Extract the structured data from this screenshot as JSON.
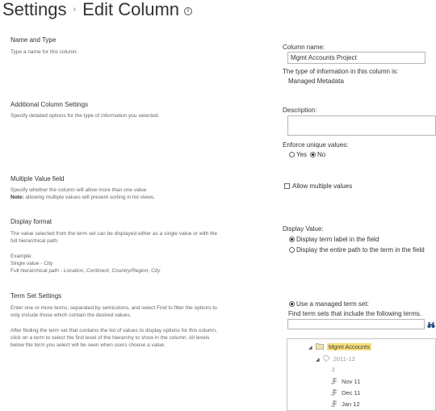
{
  "header": {
    "title": "Settings",
    "separator": "›",
    "subtitle": "Edit Column",
    "info": "i"
  },
  "sections": {
    "name_type": {
      "heading": "Name and Type",
      "desc": "Type a name for this column."
    },
    "additional": {
      "heading": "Additional Column Settings",
      "desc": "Specify detailed options for the type of information you selected."
    },
    "multiple": {
      "heading": "Multiple Value field",
      "desc1": "Specify whether the column will allow more than one value",
      "note_bold": "Note:",
      "note": " allowing multiple values will prevent sorting in list views."
    },
    "display": {
      "heading": "Display format",
      "desc1": "The value selected from the term set can be displayed either as a single value or with the",
      "desc2": "full hierarchical path.",
      "example": "Example:",
      "single": "Single value - City",
      "full_prefix": "Full hierarchical path - ",
      "full_italic": "Location, Continent, Country/Region, City"
    },
    "termset": {
      "heading": "Term Set Settings",
      "desc1": "Enter one or more terms, separated by semicolons, and select Find to filter the options to",
      "desc2": "only include those which contain the desired values.",
      "desc3": "After finding the term set that contains the list of values to display options for this column,",
      "desc4": "click on a term to select the first level of the hierarchy to show in the column. All levels",
      "desc5": "below the term you select will be seen when users choose a value."
    }
  },
  "fields": {
    "column_name_label": "Column name:",
    "column_name_value": "Mgmt Accounts Project",
    "type_label": "The type of information in this column is:",
    "type_value": "Managed Metadata",
    "description_label": "Description:",
    "description_value": "",
    "enforce_label": "Enforce unique values:",
    "enforce_yes": "Yes",
    "enforce_no": "No",
    "enforce_selected": "No",
    "allow_multiple": "Allow multiple values",
    "allow_multiple_checked": false,
    "display_value_label": "Display Value:",
    "display_opt1": "Display term label in the field",
    "display_opt2": "Display the entire path to the term in the field",
    "display_selected": "opt1",
    "use_managed": "Use a managed term set:",
    "find_label": "Find term sets that include the following terms.",
    "find_value": ""
  },
  "tree": [
    {
      "label": "Mgmt Accounts",
      "highlighted": true,
      "icon": "folder-icon"
    },
    {
      "label": "2011-12",
      "highlighted": false,
      "icon": "termset-icon"
    },
    {
      "label": "",
      "highlighted": false,
      "icon": "term-icon"
    },
    {
      "label": "Nov 11",
      "highlighted": false,
      "icon": "term-icon"
    },
    {
      "label": "Dec 11",
      "highlighted": false,
      "icon": "term-icon"
    },
    {
      "label": "Jan 12",
      "highlighted": false,
      "icon": "term-icon"
    }
  ],
  "colors": {
    "highlight": "#f7e07a",
    "border": "#b5b5b5"
  }
}
